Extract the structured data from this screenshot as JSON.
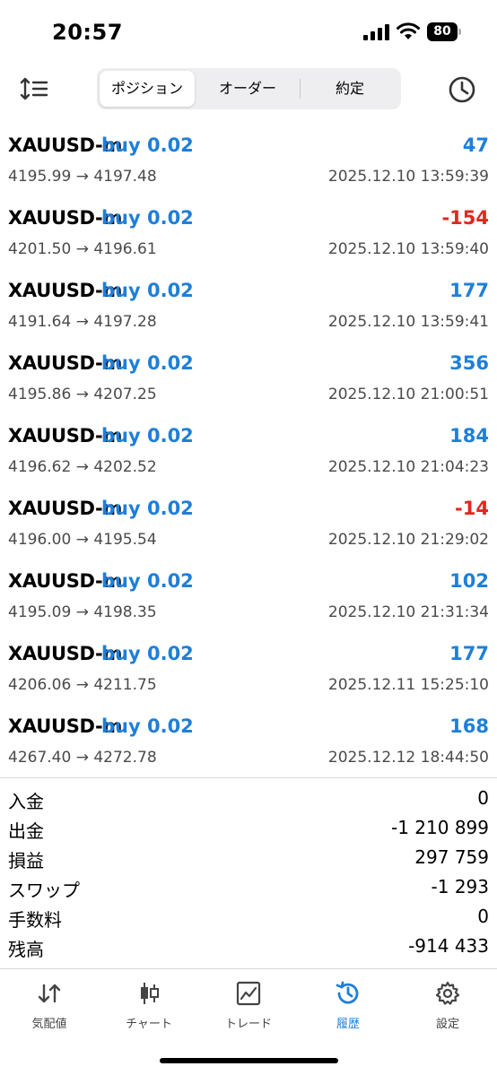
{
  "status": {
    "time": "20:57",
    "battery": "80"
  },
  "toolbar": {
    "tabs": [
      {
        "label": "ポジション",
        "active": true
      },
      {
        "label": "オーダー",
        "active": false
      },
      {
        "label": "約定",
        "active": false
      }
    ],
    "sort_icon": "sort-icon",
    "history_icon": "clock-icon"
  },
  "trades": [
    {
      "symbol": "XAUUSD-m",
      "side": "buy 0.02",
      "profit": "47",
      "negative": false,
      "prices": "4195.99 → 4197.48",
      "time": "2025.12.10 13:59:39"
    },
    {
      "symbol": "XAUUSD-m",
      "side": "buy 0.02",
      "profit": "-154",
      "negative": true,
      "prices": "4201.50 → 4196.61",
      "time": "2025.12.10 13:59:40"
    },
    {
      "symbol": "XAUUSD-m",
      "side": "buy 0.02",
      "profit": "177",
      "negative": false,
      "prices": "4191.64 → 4197.28",
      "time": "2025.12.10 13:59:41"
    },
    {
      "symbol": "XAUUSD-m",
      "side": "buy 0.02",
      "profit": "356",
      "negative": false,
      "prices": "4195.86 → 4207.25",
      "time": "2025.12.10 21:00:51"
    },
    {
      "symbol": "XAUUSD-m",
      "side": "buy 0.02",
      "profit": "184",
      "negative": false,
      "prices": "4196.62 → 4202.52",
      "time": "2025.12.10 21:04:23"
    },
    {
      "symbol": "XAUUSD-m",
      "side": "buy 0.02",
      "profit": "-14",
      "negative": true,
      "prices": "4196.00 → 4195.54",
      "time": "2025.12.10 21:29:02"
    },
    {
      "symbol": "XAUUSD-m",
      "side": "buy 0.02",
      "profit": "102",
      "negative": false,
      "prices": "4195.09 → 4198.35",
      "time": "2025.12.10 21:31:34"
    },
    {
      "symbol": "XAUUSD-m",
      "side": "buy 0.02",
      "profit": "177",
      "negative": false,
      "prices": "4206.06 → 4211.75",
      "time": "2025.12.11 15:25:10"
    },
    {
      "symbol": "XAUUSD-m",
      "side": "buy 0.02",
      "profit": "168",
      "negative": false,
      "prices": "4267.40 → 4272.78",
      "time": "2025.12.12 18:44:50"
    }
  ],
  "summary": [
    {
      "label": "入金",
      "value": "0"
    },
    {
      "label": "出金",
      "value": "-1 210 899"
    },
    {
      "label": "損益",
      "value": "297 759"
    },
    {
      "label": "スワップ",
      "value": "-1 293"
    },
    {
      "label": "手数料",
      "value": "0"
    },
    {
      "label": "残高",
      "value": "-914 433"
    }
  ],
  "tabbar": [
    {
      "label": "気配値",
      "icon": "quotes-icon",
      "active": false
    },
    {
      "label": "チャート",
      "icon": "candlestick-icon",
      "active": false
    },
    {
      "label": "トレード",
      "icon": "trade-chart-icon",
      "active": false
    },
    {
      "label": "履歴",
      "icon": "history-icon",
      "active": true
    },
    {
      "label": "設定",
      "icon": "gear-icon",
      "active": false
    }
  ],
  "colors": {
    "accent": "#1e7fd9",
    "negative": "#e0281e",
    "muted": "#4a4a4a"
  }
}
